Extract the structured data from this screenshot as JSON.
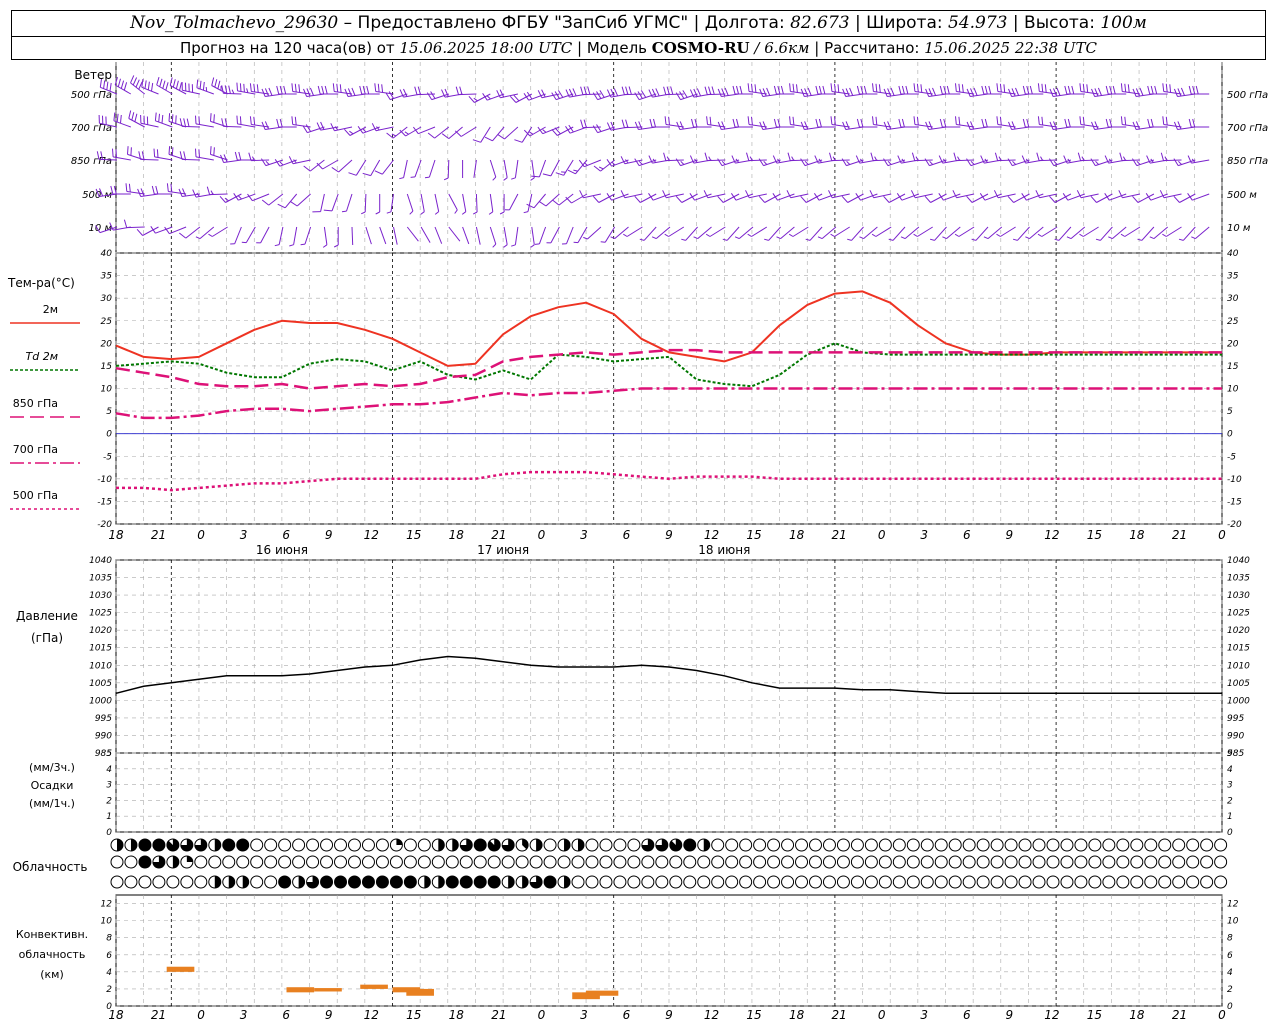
{
  "header": {
    "station": "Nov_Tolmachevo_29630",
    "dash": "–",
    "provider": "Предоставлено ФГБУ \"ЗапСиб УГМС\"",
    "lon_label": "Долгота:",
    "lon_value": "82.673",
    "lat_label": "Широта:",
    "lat_value": "54.973",
    "alt_label": "Высота:",
    "alt_value": "100м",
    "forecast_label": "Прогноз на 120 часа(ов) от",
    "forecast_start": "15.06.2025 18:00 UTC",
    "model_label": "Модель",
    "model_name": "COSMO-RU",
    "model_res": "/ 6.6км",
    "calc_label": "Рассчитано:",
    "calc_time": "15.06.2025 22:38 UTC",
    "sep": "|"
  },
  "time_axis": {
    "hour_labels": [
      "18",
      "21",
      "0",
      "3",
      "6",
      "9",
      "12",
      "15",
      "18",
      "21",
      "0",
      "3",
      "6",
      "9",
      "12",
      "15",
      "18",
      "21",
      "0",
      "3",
      "6",
      "9",
      "12",
      "15",
      "18",
      "21",
      "0"
    ],
    "day_labels": [
      "16 июня",
      "17 июня",
      "18 июня"
    ]
  },
  "colors": {
    "t2m": "#ee3322",
    "td2m": "#007700",
    "t850": "#dd1177",
    "t700": "#dd1177",
    "t500": "#dd1177",
    "wind": "#7a22cc",
    "pressure": "#000000",
    "convective": "#e88020",
    "zero_line": "#2222cc",
    "grid": "#aaaaaa"
  },
  "wind_panel": {
    "title": "Ветер",
    "levels": [
      "500 гПа",
      "700 гПа",
      "850 гПа",
      "500 м",
      "10 м"
    ]
  },
  "temp_panel": {
    "title": "Тем-ра(°C)",
    "legend": [
      "2м",
      "Td 2м",
      "850 гПа",
      "700 гПа",
      "500 гПа"
    ]
  },
  "pressure_panel": {
    "title_1": "Давление",
    "title_2": "(гПа)"
  },
  "precip_panel": {
    "title_1": "(мм/3ч.)",
    "title_2": "Осадки",
    "title_3": "(мм/1ч.)"
  },
  "cloud_panel": {
    "title": "Облачность"
  },
  "conv_panel": {
    "title_1": "Конвективн.",
    "title_2": "облачность",
    "title_3": "(км)"
  },
  "chart_data": [
    {
      "type": "line",
      "panel": "temperature",
      "ylabel": "Тем-ра(°C)",
      "ylim": [
        -20,
        40
      ],
      "yticks": [
        -20,
        -15,
        -10,
        -5,
        0,
        5,
        10,
        15,
        20,
        25,
        30,
        35,
        40
      ],
      "x": [
        0,
        3,
        6,
        9,
        12,
        15,
        18,
        21,
        24,
        27,
        30,
        33,
        36,
        39,
        42,
        45,
        48,
        51,
        54,
        57,
        60,
        63,
        66,
        69,
        72,
        75,
        78,
        81,
        84,
        87,
        90,
        93,
        96,
        99,
        102,
        105,
        108,
        111,
        114,
        117,
        120
      ],
      "series": [
        {
          "name": "2м",
          "color_key": "t2m",
          "dash": "solid",
          "values": [
            19.5,
            17,
            16.5,
            17,
            20,
            23,
            25,
            24.5,
            24.5,
            23,
            21,
            18,
            15,
            15.5,
            22,
            26,
            28,
            29,
            26.5,
            21,
            18,
            17,
            16,
            18,
            24,
            28.5,
            31,
            31.5,
            29,
            24,
            20,
            18,
            17.5,
            17.5,
            18,
            18,
            18,
            18,
            18,
            18,
            18
          ]
        },
        {
          "name": "Td 2м",
          "color_key": "td2m",
          "dash": "dot",
          "values": [
            15,
            15.5,
            16,
            15.5,
            13.5,
            12.5,
            12.5,
            15.5,
            16.5,
            16,
            14,
            16,
            13,
            12,
            14,
            12,
            17.5,
            17,
            16,
            16.5,
            17,
            12,
            11,
            10.5,
            13,
            17.5,
            20,
            18,
            17.5,
            17.5,
            17.5,
            17.5,
            17.5,
            17.5,
            17.5,
            17.5,
            17.5,
            17.5,
            17.5,
            17.5,
            17.5
          ]
        },
        {
          "name": "850 гПа",
          "color_key": "t850",
          "dash": "longdash",
          "values": [
            14.5,
            13.5,
            12.5,
            11,
            10.5,
            10.5,
            11,
            10,
            10.5,
            11,
            10.5,
            11,
            12.5,
            13,
            16,
            17,
            17.5,
            18,
            17.5,
            18,
            18.5,
            18.5,
            18,
            18,
            18,
            18,
            18,
            18,
            18,
            18,
            18,
            18,
            18,
            18,
            18,
            18,
            18,
            18,
            18,
            18,
            18
          ]
        },
        {
          "name": "700 гПа",
          "color_key": "t700",
          "dash": "dashdot",
          "values": [
            4.5,
            3.5,
            3.5,
            4,
            5,
            5.5,
            5.5,
            5,
            5.5,
            6,
            6.5,
            6.5,
            7,
            8,
            9,
            8.5,
            9,
            9,
            9.5,
            10,
            10,
            10,
            10,
            10,
            10,
            10,
            10,
            10,
            10,
            10,
            10,
            10,
            10,
            10,
            10,
            10,
            10,
            10,
            10,
            10,
            10
          ]
        },
        {
          "name": "500 гПа",
          "color_key": "t500",
          "dash": "shortdot",
          "values": [
            -12,
            -12,
            -12.5,
            -12,
            -11.5,
            -11,
            -11,
            -10.5,
            -10,
            -10,
            -10,
            -10,
            -10,
            -10,
            -9,
            -8.5,
            -8.5,
            -8.5,
            -9,
            -9.5,
            -10,
            -9.5,
            -9.5,
            -9.5,
            -10,
            -10,
            -10,
            -10,
            -10,
            -10,
            -10,
            -10,
            -10,
            -10,
            -10,
            -10,
            -10,
            -10,
            -10,
            -10,
            -10
          ]
        }
      ]
    },
    {
      "type": "line",
      "panel": "pressure",
      "ylabel": "Давление (гПа)",
      "ylim": [
        985,
        1040
      ],
      "yticks": [
        985,
        990,
        995,
        1000,
        1005,
        1010,
        1015,
        1020,
        1025,
        1030,
        1035,
        1040
      ],
      "x": [
        0,
        3,
        6,
        9,
        12,
        15,
        18,
        21,
        24,
        27,
        30,
        33,
        36,
        39,
        42,
        45,
        48,
        51,
        54,
        57,
        60,
        63,
        66,
        69,
        72,
        75,
        78,
        81,
        84,
        87,
        90,
        93,
        96,
        99,
        102,
        105,
        108,
        111,
        114,
        117,
        120
      ],
      "series": [
        {
          "name": "Давление",
          "color_key": "pressure",
          "values": [
            1002,
            1004,
            1005,
            1006,
            1007,
            1007,
            1007,
            1007.5,
            1008.5,
            1009.5,
            1010,
            1011.5,
            1012.5,
            1012,
            1011,
            1010,
            1009.5,
            1009.5,
            1009.5,
            1010,
            1009.5,
            1008.5,
            1007,
            1005,
            1003.5,
            1003.5,
            1003.5,
            1003,
            1003,
            1002.5,
            1002,
            1002,
            1002,
            1002,
            1002,
            1002,
            1002,
            1002,
            1002,
            1002,
            1002
          ]
        }
      ]
    },
    {
      "type": "bar",
      "panel": "precipitation",
      "ylabel": "Осадки",
      "ylim": [
        0,
        5
      ],
      "yticks": [
        0,
        1,
        2,
        3,
        4,
        5
      ],
      "series": []
    },
    {
      "type": "bar",
      "panel": "convective_cloud",
      "ylabel": "Конвективн. облачность (км)",
      "ylim": [
        0,
        13
      ],
      "yticks": [
        0,
        2,
        4,
        6,
        8,
        10,
        12
      ],
      "segments": [
        {
          "x0": 5.5,
          "x1": 8.5,
          "base_km": 4.0,
          "top_km": 4.6
        },
        {
          "x0": 18.5,
          "x1": 21.5,
          "base_km": 1.6,
          "top_km": 2.2
        },
        {
          "x0": 21.5,
          "x1": 24.5,
          "base_km": 1.7,
          "top_km": 2.1
        },
        {
          "x0": 26.5,
          "x1": 29.5,
          "base_km": 2.0,
          "top_km": 2.5
        },
        {
          "x0": 30.0,
          "x1": 33.0,
          "base_km": 1.6,
          "top_km": 2.2
        },
        {
          "x0": 31.5,
          "x1": 34.5,
          "base_km": 1.2,
          "top_km": 2.0
        },
        {
          "x0": 49.5,
          "x1": 52.5,
          "base_km": 0.8,
          "top_km": 1.6
        },
        {
          "x0": 51.0,
          "x1": 54.5,
          "base_km": 1.2,
          "top_km": 1.8
        }
      ]
    },
    {
      "type": "table",
      "panel": "cloudiness",
      "rows": [
        "upper",
        "middle",
        "lower"
      ],
      "cover_eighths": {
        "upper": [
          4,
          4,
          8,
          8,
          7,
          6,
          6,
          4,
          8,
          8,
          0,
          0,
          0,
          0,
          0,
          0,
          0,
          0,
          0,
          0,
          2,
          0,
          0,
          4,
          4,
          6,
          8,
          7,
          6,
          3,
          4,
          0,
          4,
          4,
          0,
          0,
          0,
          0,
          6,
          6,
          7,
          8,
          4,
          0,
          0,
          0,
          0,
          0,
          0,
          0,
          0,
          0,
          0,
          0,
          0,
          0,
          0,
          0,
          0,
          0,
          0,
          0,
          0,
          0,
          0,
          0,
          0,
          0,
          0,
          0,
          0,
          0,
          0,
          0,
          0,
          0,
          0,
          0,
          0,
          0
        ],
        "middle": [
          0,
          0,
          8,
          6,
          4,
          2,
          0,
          0,
          0,
          0,
          0,
          0,
          0,
          0,
          0,
          0,
          0,
          0,
          0,
          0,
          0,
          0,
          0,
          0,
          0,
          0,
          0,
          0,
          0,
          0,
          0,
          0,
          0,
          0,
          0,
          0,
          0,
          0,
          0,
          0,
          0,
          0,
          0,
          0,
          0,
          0,
          0,
          0,
          0,
          0,
          0,
          0,
          0,
          0,
          0,
          0,
          0,
          0,
          0,
          0,
          0,
          0,
          0,
          0,
          0,
          0,
          0,
          0,
          0,
          0,
          0,
          0,
          0,
          0,
          0,
          0,
          0,
          0,
          0,
          0
        ],
        "lower": [
          0,
          0,
          0,
          0,
          0,
          0,
          0,
          4,
          4,
          4,
          0,
          0,
          8,
          4,
          6,
          8,
          8,
          8,
          8,
          8,
          8,
          8,
          4,
          4,
          8,
          8,
          8,
          8,
          4,
          4,
          6,
          8,
          4,
          0,
          0,
          0,
          0,
          0,
          0,
          0,
          0,
          0,
          0,
          0,
          0,
          0,
          0,
          0,
          0,
          0,
          0,
          0,
          0,
          0,
          0,
          0,
          0,
          0,
          0,
          0,
          0,
          0,
          0,
          0,
          0,
          0,
          0,
          0,
          0,
          0,
          0,
          0,
          0,
          0,
          0,
          0,
          0,
          0,
          0,
          0
        ]
      }
    },
    {
      "type": "scatter",
      "panel": "wind",
      "description_levels": [
        "500 гПа",
        "700 гПа",
        "850 гПа",
        "500 м",
        "10 м"
      ],
      "direction_deg": {
        "500 гПа": [
          300,
          300,
          300,
          290,
          290,
          280,
          270,
          270,
          270,
          270,
          270,
          260,
          260,
          260,
          250,
          250,
          250,
          260,
          260,
          260,
          260,
          260,
          260,
          270,
          270,
          270,
          270,
          270,
          270,
          270,
          270,
          270,
          270,
          270,
          270,
          270,
          270,
          270,
          270,
          270,
          270
        ],
        "700 гПа": [
          290,
          290,
          290,
          280,
          280,
          280,
          270,
          270,
          260,
          250,
          250,
          240,
          240,
          230,
          220,
          220,
          240,
          250,
          260,
          260,
          270,
          270,
          270,
          270,
          270,
          270,
          270,
          270,
          270,
          270,
          270,
          270,
          270,
          270,
          270,
          270,
          270,
          270,
          270,
          270,
          270
        ],
        "850 гПа": [
          280,
          280,
          280,
          280,
          280,
          270,
          260,
          250,
          240,
          220,
          210,
          200,
          190,
          180,
          170,
          180,
          200,
          220,
          240,
          250,
          260,
          260,
          260,
          260,
          260,
          260,
          260,
          260,
          260,
          260,
          260,
          260,
          260,
          260,
          260,
          260,
          260,
          260,
          260,
          260,
          260
        ],
        "500 м": [
          270,
          270,
          270,
          270,
          260,
          250,
          240,
          220,
          200,
          190,
          180,
          170,
          160,
          170,
          180,
          200,
          220,
          240,
          250,
          250,
          250,
          250,
          250,
          250,
          250,
          250,
          250,
          250,
          250,
          250,
          250,
          250,
          250,
          250,
          250,
          250,
          250,
          250,
          250,
          250,
          250
        ],
        "10 м": [
          260,
          260,
          250,
          240,
          230,
          210,
          200,
          190,
          180,
          170,
          160,
          150,
          150,
          160,
          170,
          180,
          200,
          210,
          220,
          230,
          230,
          230,
          230,
          230,
          230,
          230,
          230,
          230,
          230,
          230,
          230,
          230,
          230,
          230,
          230,
          230,
          230,
          230,
          230,
          230,
          230
        ]
      },
      "speed_ms": {
        "500 гПа": [
          20,
          20,
          20,
          20,
          18,
          18,
          15,
          15,
          15,
          15,
          15,
          12,
          10,
          10,
          8,
          10,
          12,
          15,
          15,
          15,
          15,
          15,
          15,
          15,
          15,
          15,
          15,
          15,
          15,
          15,
          15,
          15,
          15,
          15,
          15,
          15,
          15,
          15,
          15,
          15,
          15
        ],
        "700 гПа": [
          15,
          15,
          15,
          15,
          12,
          12,
          10,
          10,
          10,
          8,
          8,
          8,
          6,
          5,
          5,
          6,
          8,
          10,
          10,
          10,
          10,
          10,
          10,
          10,
          10,
          10,
          10,
          10,
          10,
          10,
          10,
          10,
          10,
          10,
          10,
          10,
          10,
          10,
          10,
          10,
          10
        ],
        "850 гПа": [
          12,
          12,
          12,
          12,
          10,
          10,
          8,
          8,
          6,
          5,
          5,
          4,
          3,
          2,
          3,
          4,
          6,
          8,
          8,
          8,
          8,
          8,
          8,
          8,
          8,
          8,
          8,
          8,
          8,
          8,
          8,
          8,
          8,
          8,
          8,
          8,
          8,
          8,
          8,
          8,
          8
        ],
        "500 м": [
          12,
          12,
          10,
          10,
          8,
          8,
          6,
          6,
          5,
          4,
          4,
          3,
          3,
          3,
          4,
          4,
          6,
          6,
          6,
          6,
          6,
          6,
          6,
          6,
          6,
          6,
          6,
          6,
          6,
          6,
          6,
          6,
          6,
          6,
          6,
          6,
          6,
          6,
          6,
          6,
          6
        ],
        "10 м": [
          6,
          6,
          5,
          5,
          4,
          4,
          3,
          3,
          3,
          2,
          2,
          2,
          2,
          2,
          3,
          3,
          4,
          4,
          4,
          4,
          4,
          4,
          4,
          4,
          4,
          4,
          4,
          4,
          4,
          4,
          4,
          4,
          4,
          4,
          4,
          4,
          4,
          4,
          4,
          4,
          4
        ]
      }
    }
  ]
}
